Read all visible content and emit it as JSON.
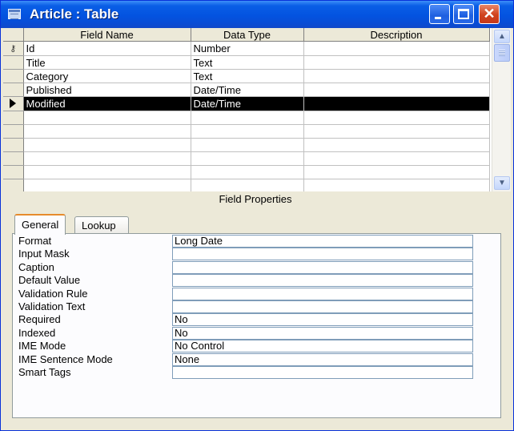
{
  "window": {
    "title": "Article : Table"
  },
  "grid": {
    "columns": [
      "Field Name",
      "Data Type",
      "Description"
    ],
    "rows": [
      {
        "field": "Id",
        "type": "Number",
        "description": "",
        "key": true
      },
      {
        "field": "Title",
        "type": "Text",
        "description": ""
      },
      {
        "field": "Category",
        "type": "Text",
        "description": ""
      },
      {
        "field": "Published",
        "type": "Date/Time",
        "description": ""
      },
      {
        "field": "Modified",
        "type": "Date/Time",
        "description": "",
        "selected": true
      }
    ]
  },
  "field_properties": {
    "heading": "Field Properties",
    "tabs": [
      "General",
      "Lookup"
    ],
    "active_tab": "General",
    "properties": [
      {
        "label": "Format",
        "value": "Long Date"
      },
      {
        "label": "Input Mask",
        "value": ""
      },
      {
        "label": "Caption",
        "value": ""
      },
      {
        "label": "Default Value",
        "value": ""
      },
      {
        "label": "Validation Rule",
        "value": ""
      },
      {
        "label": "Validation Text",
        "value": ""
      },
      {
        "label": "Required",
        "value": "No"
      },
      {
        "label": "Indexed",
        "value": "No"
      },
      {
        "label": "IME Mode",
        "value": "No Control"
      },
      {
        "label": "IME Sentence Mode",
        "value": "None"
      },
      {
        "label": "Smart Tags",
        "value": ""
      }
    ]
  },
  "colors": {
    "title_bar": "#0a5ee6",
    "selection": "#000000",
    "tab_accent": "#e68b2c"
  },
  "icons": {
    "primary_key": "key-icon",
    "current_row": "arrow-icon"
  }
}
